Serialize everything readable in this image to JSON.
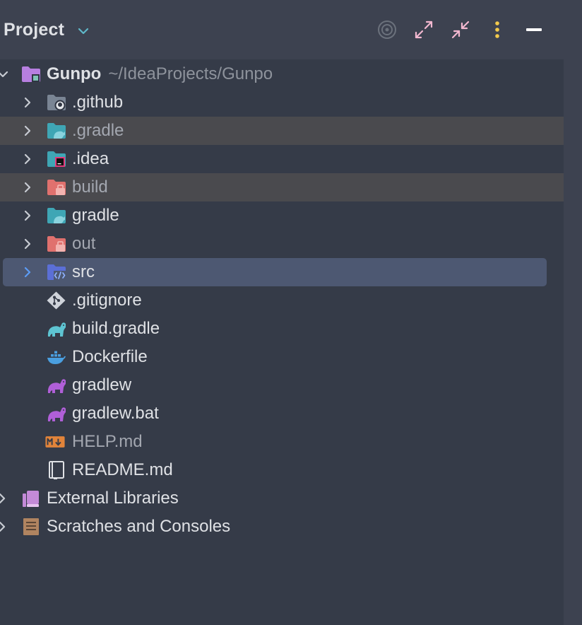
{
  "header": {
    "title": "Project",
    "buttons": [
      "locate-icon",
      "expand-all-icon",
      "collapse-all-icon",
      "more-options-icon",
      "minimize-icon"
    ]
  },
  "colors": {
    "background": "#353b48",
    "header_background": "#3d4250",
    "selection": "#4d5872",
    "excluded_highlight": "#4a4a4e",
    "accent_pink": "#f3b8d0",
    "accent_yellow": "#f2c94c"
  },
  "tree": {
    "root": {
      "name": "Gunpo",
      "path": "~/IdeaProjects/Gunpo",
      "icon": "module-folder-icon"
    },
    "items": [
      {
        "label": ".github",
        "icon": "github-folder-icon",
        "expandable": true
      },
      {
        "label": ".gradle",
        "icon": "gradle-folder-icon",
        "expandable": true,
        "excluded": true
      },
      {
        "label": ".idea",
        "icon": "idea-folder-icon",
        "expandable": true
      },
      {
        "label": "build",
        "icon": "excluded-folder-icon",
        "expandable": true,
        "excluded": true
      },
      {
        "label": "gradle",
        "icon": "gradle-folder-icon",
        "expandable": true
      },
      {
        "label": "out",
        "icon": "excluded-folder-icon",
        "expandable": true
      },
      {
        "label": "src",
        "icon": "source-folder-icon",
        "expandable": true,
        "selected": true
      },
      {
        "label": ".gitignore",
        "icon": "git-file-icon"
      },
      {
        "label": "build.gradle",
        "icon": "gradle-file-icon"
      },
      {
        "label": "Dockerfile",
        "icon": "docker-icon"
      },
      {
        "label": "gradlew",
        "icon": "gradle-script-icon"
      },
      {
        "label": "gradlew.bat",
        "icon": "gradle-script-icon"
      },
      {
        "label": "HELP.md",
        "icon": "markdown-icon"
      },
      {
        "label": "README.md",
        "icon": "readme-icon"
      }
    ],
    "extra": [
      {
        "label": "External Libraries",
        "icon": "libraries-icon"
      },
      {
        "label": "Scratches and Consoles",
        "icon": "scratches-icon"
      }
    ]
  }
}
